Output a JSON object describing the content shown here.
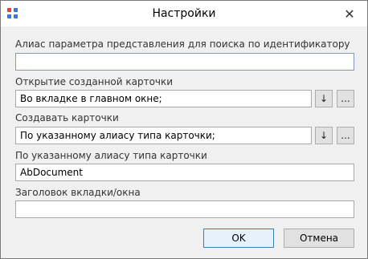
{
  "window": {
    "title": "Настройки",
    "close_glyph": "✕",
    "icon_colors": [
      "#e8423f",
      "#2f7fd8",
      "#2f7fd8",
      "#2f7fd8"
    ]
  },
  "fields": [
    {
      "label": "Алиас параметра представления для поиска по идентификатору строки",
      "value": ""
    },
    {
      "label": "Открытие созданной карточки",
      "value": "Во вкладке в главном окне;"
    },
    {
      "label": "Создавать карточки",
      "value": "По указанному алиасу типа карточки;"
    },
    {
      "label": "По указанному алиасу типа карточки",
      "value": "AbDocument"
    },
    {
      "label": "Заголовок вкладки/окна",
      "value": ""
    }
  ],
  "buttons": {
    "arrow_glyph": "↓",
    "ellipsis": "...",
    "ok": "OK",
    "cancel": "Отмена"
  }
}
